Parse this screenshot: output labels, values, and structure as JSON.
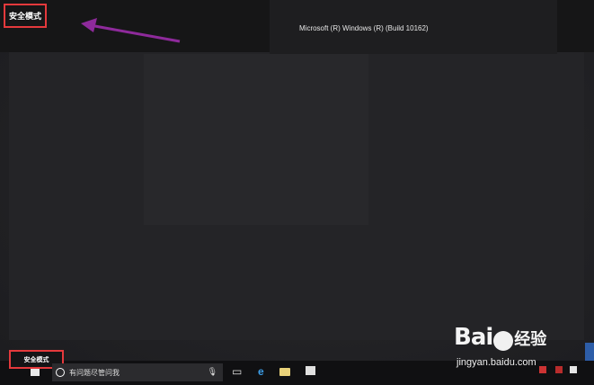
{
  "screen": {
    "mode_label_top": "安全模式",
    "build_info": "Microsoft (R) Windows (R) (Build 10162)",
    "mode_label_bottom": "安全模式"
  },
  "taskbar": {
    "search_placeholder": "有问题尽管问我",
    "icons": [
      "windows-start-icon",
      "cortana-icon",
      "microphone-icon",
      "task-view-icon",
      "edge-icon",
      "file-explorer-icon",
      "store-icon"
    ]
  },
  "annotations": {
    "highlight_color": "#e4393c",
    "arrow_color": "#8e2a9b"
  },
  "watermark": {
    "brand": "Bai",
    "brand_suffix": "经验",
    "url": "jingyan.baidu.com"
  }
}
